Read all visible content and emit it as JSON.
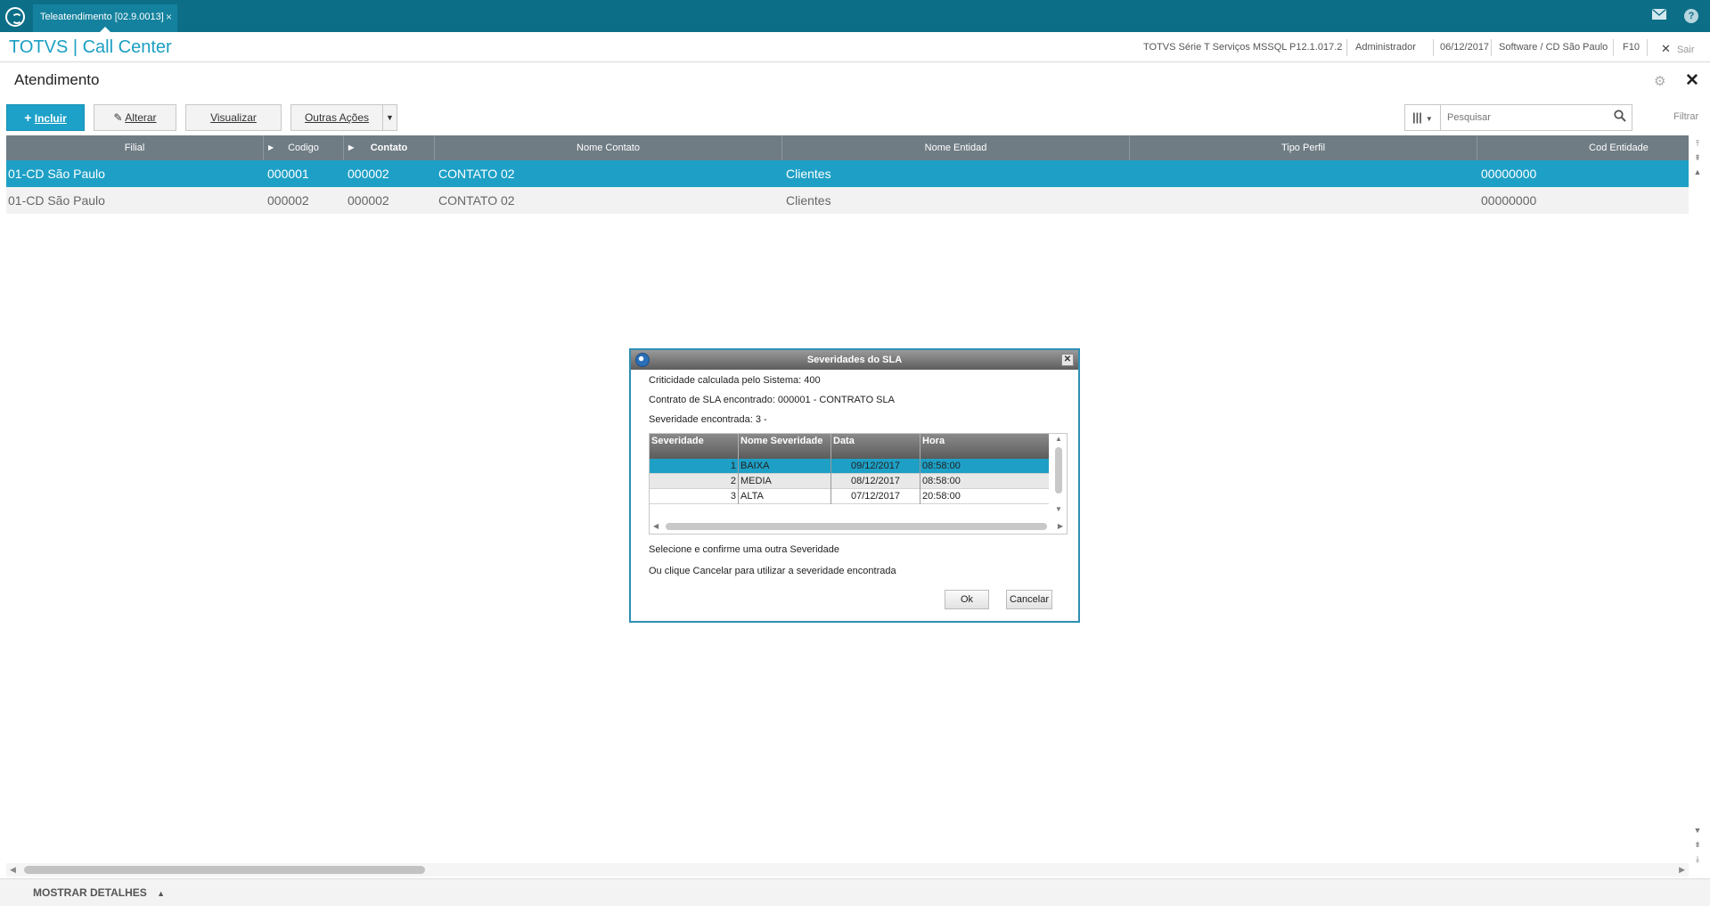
{
  "topbar": {
    "tab_label": "Teleatendimento [02.9.0013]",
    "tab_close": "×",
    "mail_icon": "mail-icon",
    "help_label": "?"
  },
  "header": {
    "app_title": "TOTVS | Call Center",
    "environment": "TOTVS Série T Serviços MSSQL P12.1.017.2",
    "user": "Administrador",
    "date": "06/12/2017",
    "branch": "Software / CD São Paulo",
    "shortcut": "F10",
    "exit_label": "Sair"
  },
  "page": {
    "title": "Atendimento"
  },
  "toolbar": {
    "incluir": "Incluir",
    "alterar": "Alterar",
    "visualizar": "Visualizar",
    "outras_acoes": "Outras Ações",
    "search_placeholder": "Pesquisar",
    "filter_label": "Filtrar"
  },
  "grid": {
    "columns": [
      "Filial",
      "Codigo",
      "Contato",
      "Nome Contato",
      "Nome Entidad",
      "Tipo Perfil",
      "Cod Entidade"
    ],
    "rows": [
      {
        "filial": "01-CD São Paulo",
        "codigo": "000001",
        "contato": "000002",
        "nome_contato": "CONTATO 02",
        "nome_entidad": "Clientes",
        "tipo_perfil": "",
        "cod_entidade": "00000000"
      },
      {
        "filial": "01-CD São Paulo",
        "codigo": "000002",
        "contato": "000002",
        "nome_contato": "CONTATO 02",
        "nome_entidad": "Clientes",
        "tipo_perfil": "",
        "cod_entidade": "00000000"
      }
    ]
  },
  "details": {
    "label": "MOSTRAR DETALHES"
  },
  "modal": {
    "title": "Severidades do SLA",
    "line1": "Criticidade calculada pelo Sistema: 400",
    "line2": "Contrato de SLA encontrado: 000001 - CONTRATO SLA",
    "line3": "Severidade encontrada:   3 -",
    "columns": [
      "Severidade",
      "Nome Severidade",
      "Data",
      "Hora"
    ],
    "rows": [
      {
        "severidade": "1",
        "nome": "BAIXA",
        "data": "09/12/2017",
        "hora": "08:58:00"
      },
      {
        "severidade": "2",
        "nome": "MEDIA",
        "data": "08/12/2017",
        "hora": "08:58:00"
      },
      {
        "severidade": "3",
        "nome": "ALTA",
        "data": "07/12/2017",
        "hora": "20:58:00"
      }
    ],
    "hint1": "Selecione e confirme uma outra Severidade",
    "hint2": "Ou clique Cancelar para utilizar a severidade encontrada",
    "ok_label": "Ok",
    "cancel_label": "Cancelar"
  },
  "colors": {
    "topbar": "#0d6e87",
    "accent": "#1da1c8",
    "selected_row": "#1ea0c6",
    "grid_header": "#6f7c84"
  }
}
